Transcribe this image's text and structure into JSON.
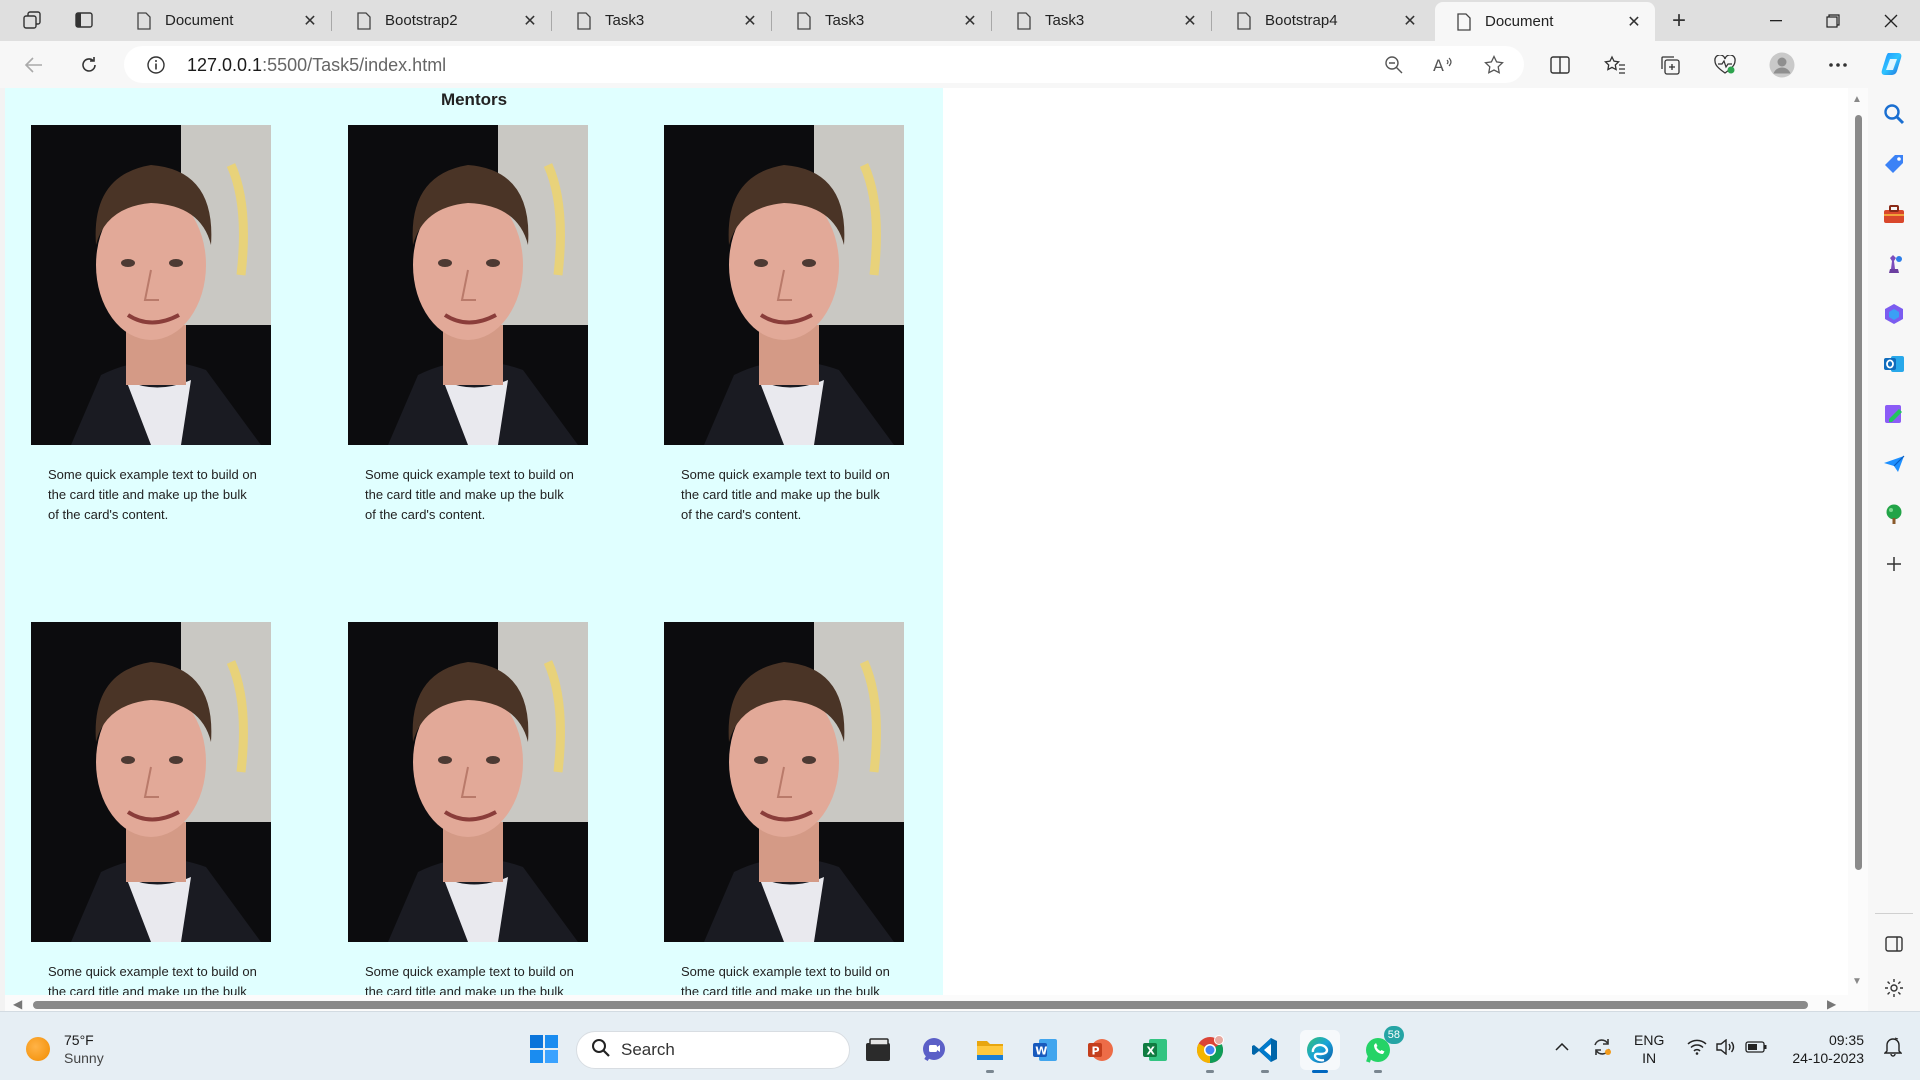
{
  "browser": {
    "tabs": [
      {
        "title": "Document",
        "active": false
      },
      {
        "title": "Bootstrap2",
        "active": false
      },
      {
        "title": "Task3",
        "active": false
      },
      {
        "title": "Task3",
        "active": false
      },
      {
        "title": "Task3",
        "active": false
      },
      {
        "title": "Bootstrap4",
        "active": false
      },
      {
        "title": "Document",
        "active": true
      }
    ],
    "close_glyph": "✕",
    "new_tab_glyph": "+",
    "address": {
      "host": "127.0.0.1",
      "path": ":5500/Task5/index.html"
    }
  },
  "page": {
    "heading": "Mentors",
    "cards": [
      {
        "text": "Some quick example text to build on the card title and make up the bulk of the card's content."
      },
      {
        "text": "Some quick example text to build on the card title and make up the bulk of the card's content."
      },
      {
        "text": "Some quick example text to build on the card title and make up the bulk of the card's content."
      },
      {
        "text": "Some quick example text to build on the card title and make up the bulk of the card's content."
      },
      {
        "text": "Some quick example text to build on the card title and make up the bulk of the card's content."
      },
      {
        "text": "Some quick example text to build on the card title and make up the bulk of the card's content."
      }
    ],
    "background_color": "#e0ffff"
  },
  "taskbar": {
    "weather": {
      "temp": "75°F",
      "condition": "Sunny"
    },
    "search_label": "Search",
    "whatsapp_badge": "58",
    "language": {
      "line1": "ENG",
      "line2": "IN"
    },
    "clock": {
      "time": "09:35",
      "date": "24-10-2023"
    }
  },
  "icons": {
    "sidebar": [
      "search-icon",
      "shopping-tag-icon",
      "toolbox-icon",
      "chess-icon",
      "microsoft365-icon",
      "outlook-icon",
      "designer-icon",
      "send-icon",
      "tree-icon",
      "add-icon"
    ],
    "taskbar_apps": [
      "file-manager-icon",
      "teams-chat-icon",
      "file-explorer-icon",
      "word-icon",
      "powerpoint-icon",
      "excel-icon",
      "chrome-icon",
      "vscode-icon",
      "edge-icon",
      "whatsapp-icon"
    ]
  }
}
